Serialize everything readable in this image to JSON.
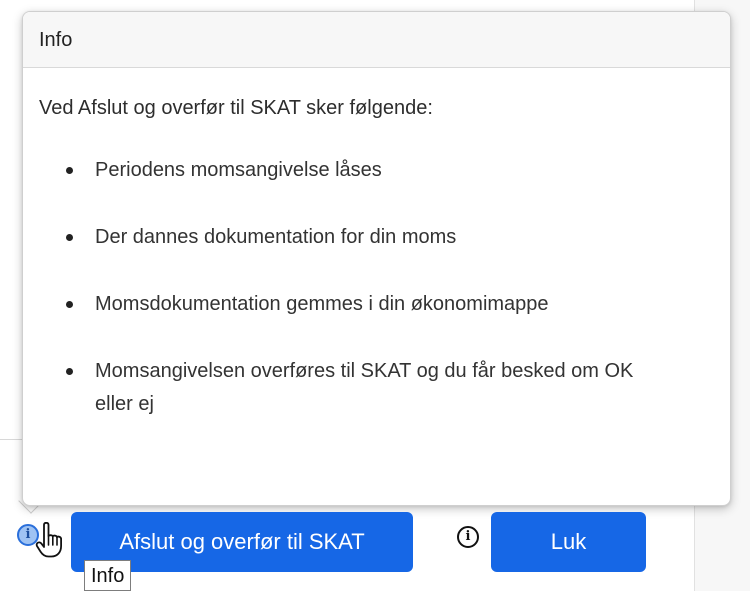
{
  "popover": {
    "title": "Info",
    "intro": "Ved Afslut og overfør til SKAT sker følgende:",
    "items": [
      "Periodens momsangivelse låses",
      "Der dannes dokumentation for din moms",
      "Momsdokumentation gemmes i din økonomimappe",
      "Momsangivelsen overføres til SKAT og du får besked om OK eller ej"
    ]
  },
  "actions": {
    "primary_label": "Afslut og overfør til SKAT",
    "close_label": "Luk",
    "info_icon": "i"
  },
  "tooltip": {
    "text": "Info"
  },
  "colors": {
    "primary": "#1667e6",
    "header_bg": "#f7f7f7",
    "text": "#333333"
  },
  "icons": {
    "left_info": "info-circle-icon",
    "right_info": "info-circle-icon",
    "cursor": "hand-pointer-icon"
  }
}
